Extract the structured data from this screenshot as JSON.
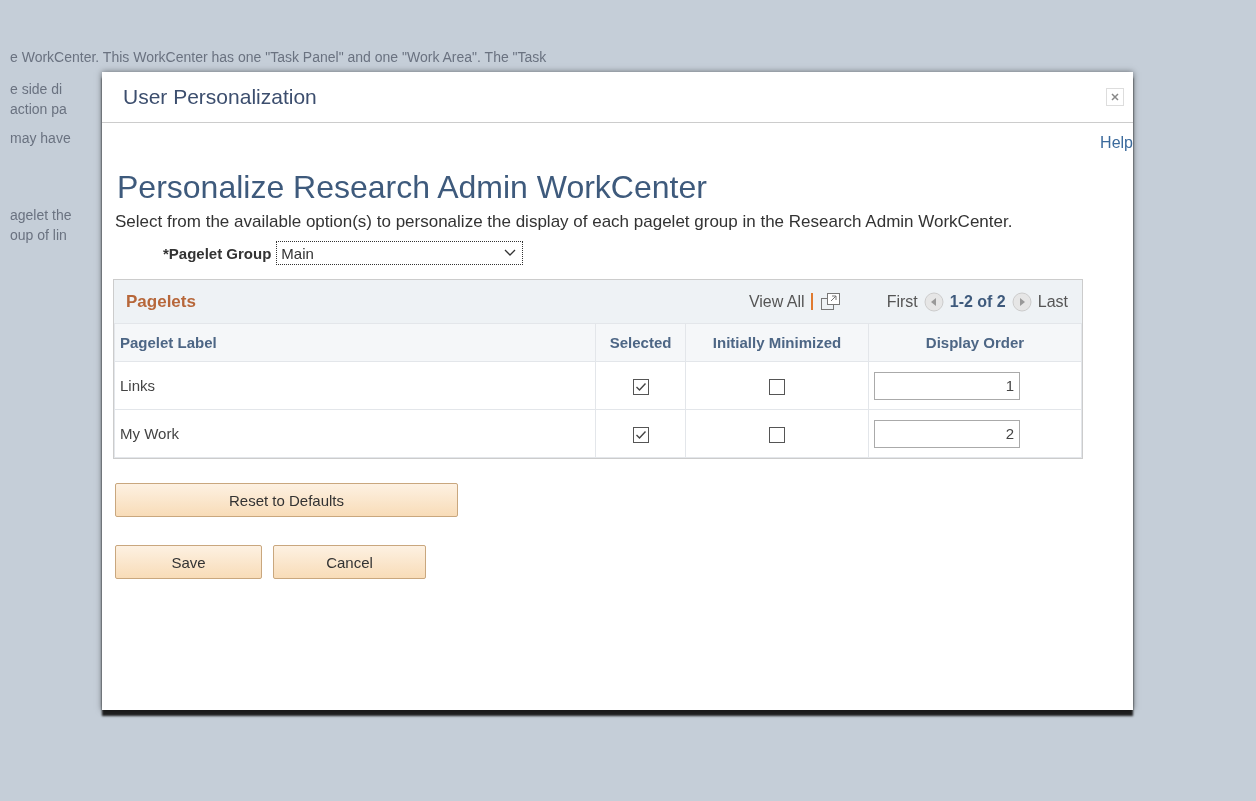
{
  "background_paragraphs": [
    [
      "e WorkCenter. This WorkCenter has one \"Task Panel\" and one \"Work Area\". The \"Task"
    ],
    [
      "e side di",
      "action pa"
    ],
    [
      "may have"
    ],
    [
      "agelet the",
      "oup of lin"
    ]
  ],
  "dialog": {
    "title": "User Personalization",
    "help_link": "Help",
    "heading": "Personalize Research Admin WorkCenter",
    "description": "Select from the available option(s) to personalize the display of each pagelet group in the Research Admin WorkCenter.",
    "pagelet_group": {
      "label": "*Pagelet Group",
      "value": "Main"
    },
    "grid": {
      "title": "Pagelets",
      "view_all": "View All",
      "first": "First",
      "range": "1-2 of 2",
      "last": "Last",
      "columns": [
        "Pagelet Label",
        "Selected",
        "Initially Minimized",
        "Display Order"
      ],
      "rows": [
        {
          "label": "Links",
          "selected": true,
          "initially_minimized": false,
          "display_order": "1"
        },
        {
          "label": "My Work",
          "selected": true,
          "initially_minimized": false,
          "display_order": "2"
        }
      ]
    },
    "buttons": {
      "reset": "Reset to Defaults",
      "save": "Save",
      "cancel": "Cancel"
    }
  }
}
